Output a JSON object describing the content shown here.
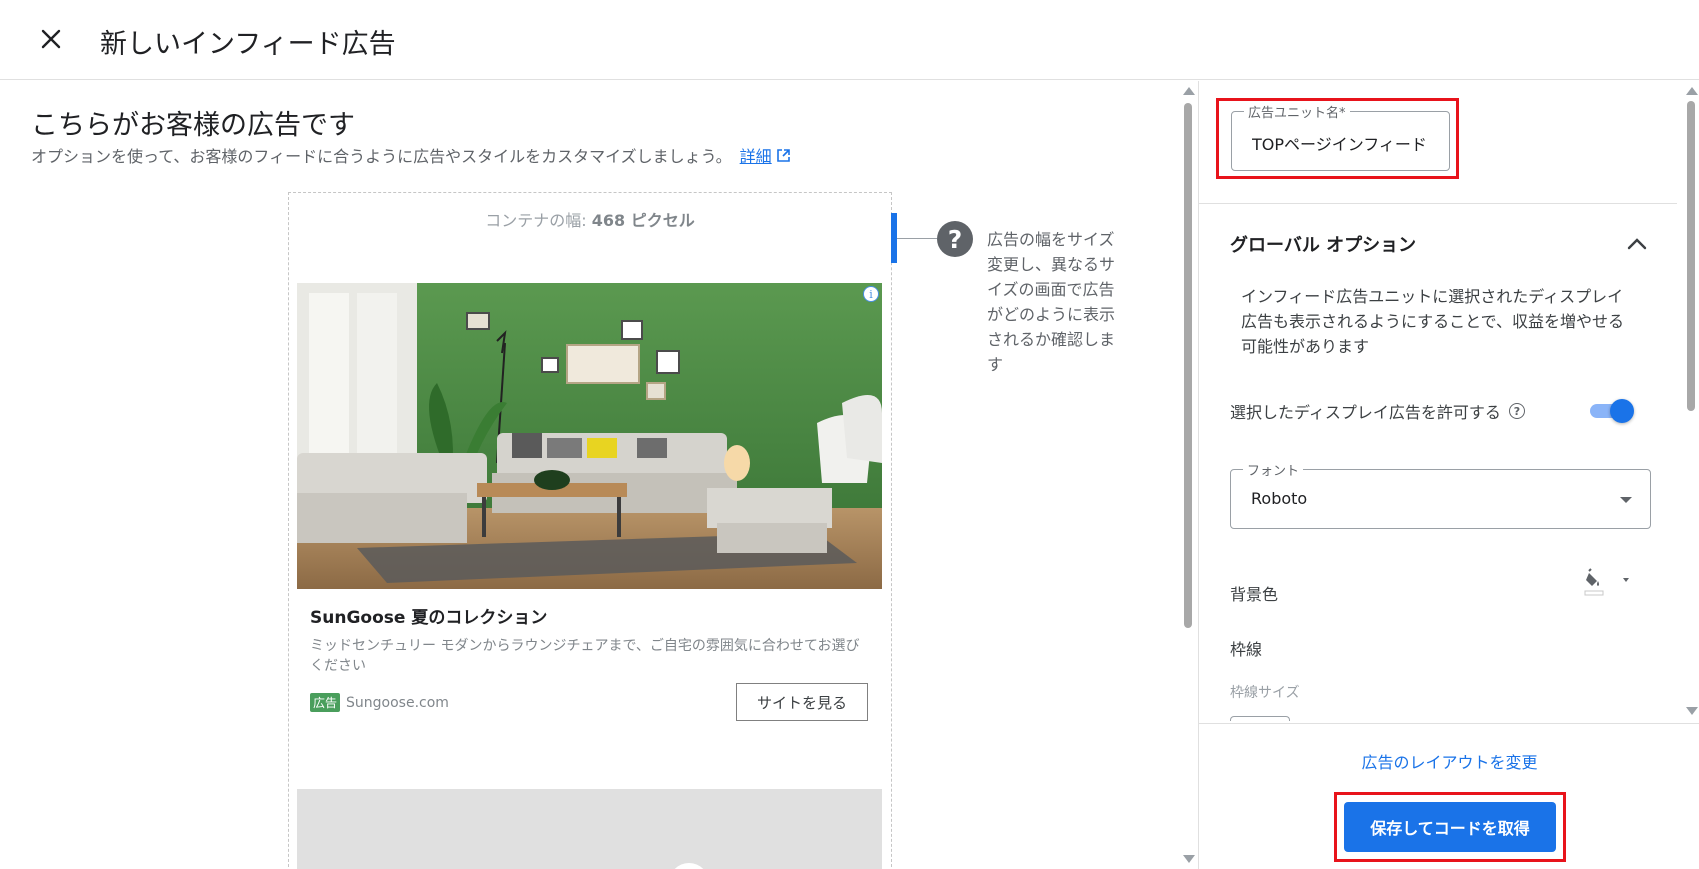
{
  "header": {
    "title": "新しいインフィード広告"
  },
  "preview": {
    "title": "こちらがお客様の広告です",
    "subtitle": "オプションを使って、お客様のフィードに合うように広告やスタイルをカスタマイズしましょう。",
    "learn_more": "詳細",
    "container_width_prefix": "コンテナの幅:",
    "container_width_value": "468 ピクセル",
    "ad": {
      "title": "SunGoose 夏のコレクション",
      "description": "ミッドセンチュリー モダンからラウンジチェアまで、ご自宅の雰囲気に合わせてお選びください",
      "badge": "広告",
      "domain": "Sungoose.com",
      "cta": "サイトを見る",
      "adchoices": "i"
    },
    "help_text": "広告の幅をサイズ変更し、異なるサイズの画面で広告がどのように表示されるか確認します"
  },
  "settings": {
    "ad_unit_name_label": "広告ユニット名*",
    "ad_unit_name_value": "TOPページインフィード",
    "section_title": "グローバル オプション",
    "section_desc": "インフィード広告ユニットに選択されたディスプレイ広告も表示されるようにすることで、収益を増やせる可能性があります",
    "allow_display_label": "選択したディスプレイ広告を許可する",
    "allow_display_enabled": true,
    "font_label": "フォント",
    "font_value": "Roboto",
    "background_label": "背景色",
    "border_label": "枠線",
    "border_size_label": "枠線サイズ"
  },
  "footer": {
    "change_layout": "広告のレイアウトを変更",
    "save_button": "保存してコードを取得"
  },
  "colors": {
    "accent": "#1a73e8",
    "highlight": "#e8131b",
    "ad_badge": "#4a9e5c"
  }
}
